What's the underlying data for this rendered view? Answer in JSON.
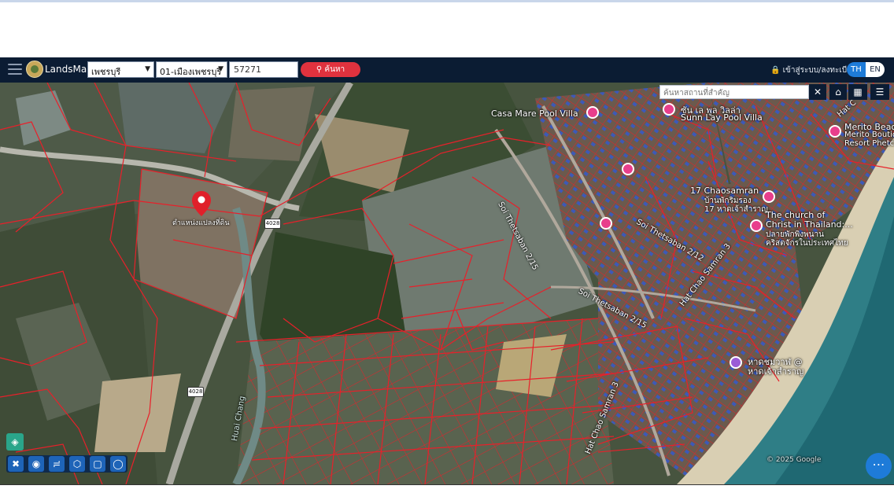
{
  "header": {
    "brand": "LandsMaps",
    "province": "เพชรบุรี",
    "district": "01-เมืองเพชรบุรี",
    "parcel_number": "57271",
    "search_label": "ค้นหา",
    "login_label": "เข้าสู่ระบบ/ลงทะเบียน",
    "lang_th": "TH",
    "lang_en": "EN"
  },
  "map": {
    "place_search_placeholder": "ค้นหาสถานที่สำคัญ",
    "close_symbol": "✕",
    "marker_label": "ตำแหน่งแปลงที่ดิน",
    "poi": [
      "Casa Mare Pool Villa",
      "ซัน เล พูล วิลล่า",
      "Sunn Lay Pool Villa",
      "Merito Beac",
      "Merito Boutique",
      "Resort Phetch",
      "17 Chaosamran",
      "บ้านพักริมรอง",
      "17 หาดเจ้าสำราญ",
      "The church of",
      "Christ in Thailand:...",
      "ปลายพักพิงพนาน",
      "คริสตจักรในประเทศไทย",
      "หาดชมวาฬ @",
      "หาดเจ้าสำราญ"
    ],
    "roads": {
      "road_4028": "4028",
      "soi_215_a": "Soi Thetsaban 2/15",
      "soi_212": "Soi Thetsaban 2/12",
      "hat_chao_samran_3": "Hat Chao Samran 3",
      "soi_215_b": "Soi Thetsaban 2/15",
      "hat_chao_samran_3b": "Hat Chao Samran 3",
      "huai_chang": "Huai Chang",
      "hat_c": "Hat C"
    },
    "copyright": "© 2025 Google"
  },
  "icons": {
    "home": "home-icon",
    "grid": "grid-icon",
    "layers": "layers-icon",
    "more": "more-icon"
  },
  "colors": {
    "navbar": "#0b1c33",
    "search_button": "#e0323e",
    "parcel_lines": "#e8202a",
    "poi_marker": "#e83e8c",
    "fab": "#1e7bd8"
  }
}
